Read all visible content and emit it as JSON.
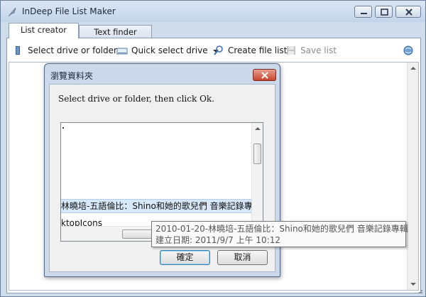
{
  "window": {
    "title": "InDeep File List Maker"
  },
  "tabs": [
    {
      "label": "List creator",
      "active": true
    },
    {
      "label": "Text finder",
      "active": false
    }
  ],
  "toolbar": {
    "select_drive": "Select drive or folder",
    "quick_select": "Quick select drive",
    "create_list": "Create file list",
    "save_list": "Save list"
  },
  "dialog": {
    "title": "瀏覽資料夾",
    "message": "Select drive or folder, then click Ok.",
    "tree": {
      "selected_item": "林曉培-五語倫比：Shino和她的歌兒們 音樂記錄專輯",
      "item": "ktopIcons"
    },
    "ok_label": "確定",
    "cancel_label": "取消"
  },
  "tooltip": {
    "line1": "2010-01-20-林曉培-五語倫比：Shino和她的歌兒們 音樂記錄專輯",
    "line2": "建立日期: 2011/9/7 上午 10:12"
  },
  "colors": {
    "titlebar": "#c3d4ea",
    "selection": "#d6e8fa",
    "close_button": "#c8452f"
  }
}
